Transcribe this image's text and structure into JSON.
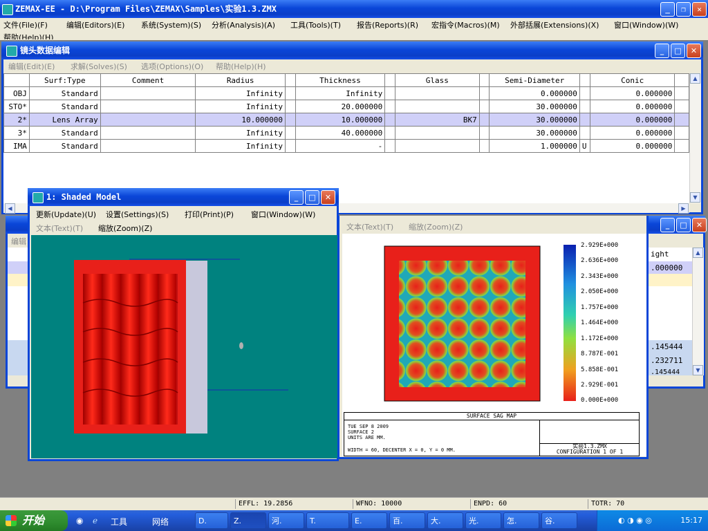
{
  "app": {
    "title": "ZEMAX-EE - D:\\Program Files\\ZEMAX\\Samples\\实验1.3.ZMX",
    "menu": [
      "文件(File)(F)",
      "编辑(Editors)(E)",
      "系统(System)(S)",
      "分析(Analysis)(A)",
      "工具(Tools)(T)",
      "报告(Reports)(R)",
      "宏指令(Macros)(M)",
      "外部括展(Extensions)(X)",
      "窗口(Window)(W)"
    ],
    "menu_overflow": "帮助(Help)(H)"
  },
  "lens_editor": {
    "title": "镜头数据编辑",
    "menu": [
      "编辑(Edit)(E)",
      "求解(Solves)(S)",
      "选项(Options)(O)",
      "帮助(Help)(H)"
    ],
    "columns": [
      "",
      "Surf:Type",
      "Comment",
      "Radius",
      "",
      "Thickness",
      "",
      "Glass",
      "",
      "Semi-Diameter",
      "",
      "Conic",
      ""
    ],
    "rows": [
      {
        "surf": "OBJ",
        "type": "Standard",
        "comment": "",
        "radius": "Infinity",
        "thickness": "Infinity",
        "glass": "",
        "semi": "0.000000",
        "semi_flag": "",
        "conic": "0.000000"
      },
      {
        "surf": "STO*",
        "type": "Standard",
        "comment": "",
        "radius": "Infinity",
        "thickness": "20.000000",
        "glass": "",
        "semi": "30.000000",
        "semi_flag": "",
        "conic": "0.000000"
      },
      {
        "surf": "2*",
        "type": "Lens Array",
        "comment": "",
        "radius": "10.000000",
        "thickness": "10.000000",
        "glass": "BK7",
        "semi": "30.000000",
        "semi_flag": "",
        "conic": "0.000000"
      },
      {
        "surf": "3*",
        "type": "Standard",
        "comment": "",
        "radius": "Infinity",
        "thickness": "40.000000",
        "glass": "",
        "semi": "30.000000",
        "semi_flag": "",
        "conic": "0.000000"
      },
      {
        "surf": "IMA",
        "type": "Standard",
        "comment": "",
        "radius": "Infinity",
        "thickness": "-",
        "glass": "",
        "semi": "1.000000",
        "semi_flag": "U",
        "conic": "0.000000"
      }
    ]
  },
  "bg_editor": {
    "menu_first": "编辑",
    "header_partial": "ight",
    "values": [
      ".000000",
      ".145444",
      ".232711",
      ".145444"
    ]
  },
  "shaded_model": {
    "title": "1: Shaded Model",
    "menu": [
      "更新(Update)(U)",
      "设置(Settings)(S)",
      "打印(Print)(P)",
      "窗口(Window)(W)"
    ],
    "menu2": [
      "文本(Text)(T)",
      "缩放(Zoom)(Z)"
    ]
  },
  "sag_map": {
    "menu": [
      "文本(Text)(T)",
      "缩放(Zoom)(Z)"
    ],
    "legend": [
      "2.929E+000",
      "2.636E+000",
      "2.343E+000",
      "2.050E+000",
      "1.757E+000",
      "1.464E+000",
      "1.172E+000",
      "8.787E-001",
      "5.858E-001",
      "2.929E-001",
      "0.000E+000"
    ],
    "caption": "SURFACE SAG MAP",
    "info_lines": [
      "TUE SEP 8 2009",
      "SURFACE 2",
      "UNITS ARE  MM."
    ],
    "info_footer": "WIDTH = 60, DECENTER X = 0, Y = 0  MM.",
    "file": "实验1.3.ZMX",
    "config": "CONFIGURATION 1 OF 1"
  },
  "status": {
    "effl": "EFFL: 19.2856",
    "wfno": "WFNO: 10000",
    "enpd": "ENPD: 60",
    "totr": "TOTR: 70"
  },
  "taskbar": {
    "start": "开始",
    "items": [
      "工具",
      "网络",
      "D.",
      "Z.",
      "河.",
      "T.",
      "E.",
      "百.",
      "大.",
      "光.",
      "怎.",
      "谷."
    ],
    "clock": "15:17"
  },
  "colors": {
    "xp_blue": "#0a46d8",
    "teal_bg": "#00827f",
    "red": "#e8201a"
  }
}
